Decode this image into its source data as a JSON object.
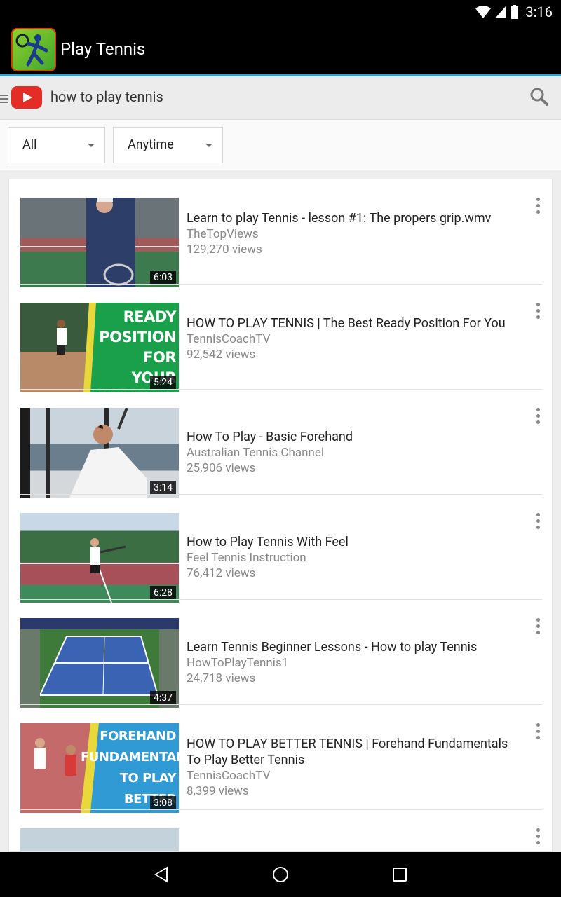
{
  "status_bar": {
    "time": "3:16"
  },
  "app_bar": {
    "title": "Play Tennis"
  },
  "search": {
    "query": "how to play tennis"
  },
  "filters": {
    "type": "All",
    "time": "Anytime"
  },
  "videos": [
    {
      "title": "Learn to play Tennis - lesson #1: The propers grip.wmv",
      "channel": "TheTopViews",
      "views": "129,270 views",
      "duration": "6:03"
    },
    {
      "title": "HOW TO PLAY TENNIS | The Best Ready Position For You",
      "channel": "TennisCoachTV",
      "views": "92,542 views",
      "duration": "5:24",
      "thumb_text": "READY POSITION FOR YOUR FOREHAND"
    },
    {
      "title": "How To Play - Basic Forehand",
      "channel": "Australian Tennis Channel",
      "views": "25,906 views",
      "duration": "3:14"
    },
    {
      "title": "How to Play Tennis With Feel",
      "channel": "Feel Tennis Instruction",
      "views": "76,412 views",
      "duration": "6:28"
    },
    {
      "title": "Learn Tennis Beginner Lessons - How to play Tennis",
      "channel": "HowToPlayTennis1",
      "views": "24,718 views",
      "duration": "4:37"
    },
    {
      "title": "HOW TO PLAY BETTER TENNIS | Forehand Fundamentals To Play Better Tennis",
      "channel": "TennisCoachTV",
      "views": "8,399 views",
      "duration": "3:08",
      "thumb_text": "FOREHAND FUNDAMENTALS TO PLAY BETTER TENNIS"
    }
  ],
  "colors": {
    "accent": "#29a3d9",
    "youtube_red": "#e52d27"
  }
}
